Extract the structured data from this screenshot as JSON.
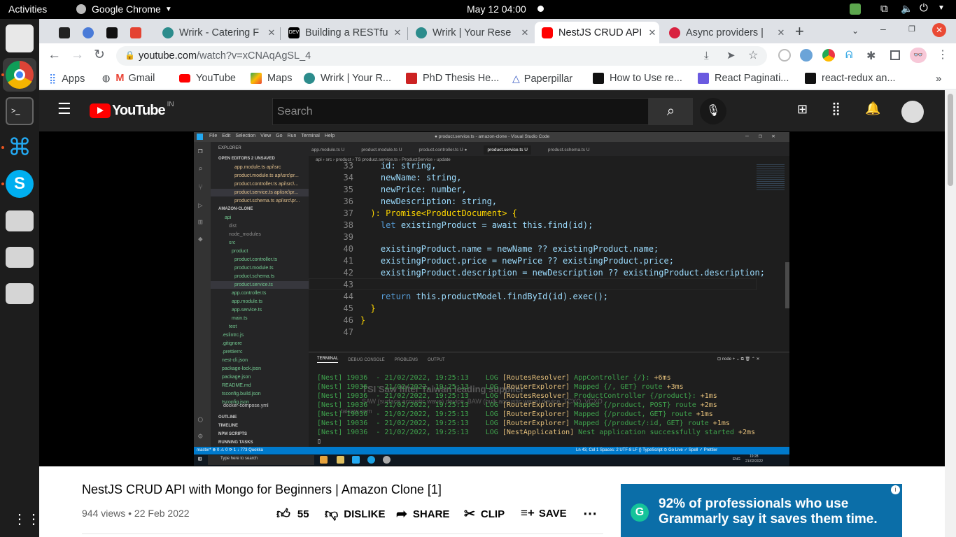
{
  "topbar": {
    "activities": "Activities",
    "app": "Google Chrome",
    "datetime": "May 12  04:00"
  },
  "tabs": [
    {
      "title": ""
    },
    {
      "title": ""
    },
    {
      "title": ""
    },
    {
      "title": ""
    },
    {
      "title": "Wrirk - Catering F"
    },
    {
      "title": "Building a RESTfu"
    },
    {
      "title": "Wrirk | Your Rese"
    },
    {
      "title": "NestJS CRUD API"
    },
    {
      "title": "Async providers |"
    }
  ],
  "omnibox": {
    "host": "youtube.com",
    "path": "/watch?v=xCNAqAgSL_4"
  },
  "bookmarks": [
    "Apps",
    "Gmail",
    "YouTube",
    "Maps",
    "Wrirk | Your R...",
    "PhD Thesis He...",
    "Paperpillar",
    "How to Use re...",
    "React Paginati...",
    "react-redux an..."
  ],
  "youtube": {
    "logo": "YouTube",
    "region": "IN",
    "search_placeholder": "Search",
    "video_title": "NestJS CRUD API with Mongo for Beginners | Amazon Clone [1]",
    "views_date": "944 views • 22 Feb 2022",
    "likes": "55",
    "dislike": "DISLIKE",
    "share": "SHARE",
    "clip": "CLIP",
    "save": "SAVE",
    "ad_text_1": "92% of professionals who use",
    "ad_text_2": "Grammarly say it saves them time."
  },
  "vscode": {
    "menu": [
      "File",
      "Edit",
      "Selection",
      "View",
      "Go",
      "Run",
      "Terminal",
      "Help"
    ],
    "window_title": "● product.service.ts - amazon-clone - Visual Studio Code",
    "editor_tabs": [
      "app.module.ts U",
      "product.module.ts U",
      "product.controller.ts U ●",
      "product.service.ts U",
      "product.schema.ts U"
    ],
    "breadcrumb": "api › src › product › TS product.service.ts › ProductService › update",
    "explorer_title": "EXPLORER",
    "open_editors": "OPEN EDITORS  2 UNSAVED",
    "open_files": [
      "app.module.ts api\\src",
      "product.module.ts api\\src\\pr...",
      "product.controller.ts api\\src\\...",
      "product.service.ts api\\src\\pr...",
      "product.schema.ts api\\src\\pr..."
    ],
    "project": "AMAZON-CLONE",
    "tree": [
      "api",
      "dist",
      "node_modules",
      "src",
      "product",
      "product.controller.ts",
      "product.module.ts",
      "product.schema.ts",
      "product.service.ts",
      "app.controller.ts",
      "app.module.ts",
      "app.service.ts",
      "main.ts",
      "test",
      ".eslintrc.js",
      ".gitignore",
      ".prettierrc",
      "nest-cli.json",
      "package-lock.json",
      "package.json",
      "README.md",
      "tsconfig.build.json",
      "tsconfig.json",
      "docker-compose.yml"
    ],
    "sections": [
      "OUTLINE",
      "TIMELINE",
      "NPM SCRIPTS",
      "RUNNING TASKS"
    ],
    "code_lines": [
      {
        "n": "33",
        "t": "    id: string,"
      },
      {
        "n": "34",
        "t": "    newName: string,"
      },
      {
        "n": "35",
        "t": "    newPrice: number,"
      },
      {
        "n": "36",
        "t": "    newDescription: string,"
      },
      {
        "n": "37",
        "t": "  ): Promise<ProductDocument> {"
      },
      {
        "n": "38",
        "t": "    let existingProduct = await this.find(id);"
      },
      {
        "n": "39",
        "t": ""
      },
      {
        "n": "40",
        "t": "    existingProduct.name = newName ?? existingProduct.name;"
      },
      {
        "n": "41",
        "t": "    existingProduct.price = newPrice ?? existingProduct.price;"
      },
      {
        "n": "42",
        "t": "    existingProduct.description = newDescription ?? existingProduct.description;"
      },
      {
        "n": "43",
        "t": ""
      },
      {
        "n": "44",
        "t": "    return this.productModel.findById(id).exec();"
      },
      {
        "n": "45",
        "t": "  }"
      },
      {
        "n": "46",
        "t": "}"
      },
      {
        "n": "47",
        "t": ""
      }
    ],
    "panel_tabs": [
      "TERMINAL",
      "DEBUG CONSOLE",
      "PROBLEMS",
      "OUTPUT"
    ],
    "terminal_shell": "node",
    "terminal_lines": [
      {
        "p": "[Nest] 19036  - 21/02/2022, 19:25:13",
        "l": "LOG",
        "c": "[RoutesResolver]",
        "m": "AppController {/}:",
        "t": "+6ms"
      },
      {
        "p": "[Nest] 19036  - 21/02/2022, 19:25:13",
        "l": "LOG",
        "c": "[RouterExplorer]",
        "m": "Mapped {/, GET} route",
        "t": "+3ms"
      },
      {
        "p": "[Nest] 19036  - 21/02/2022, 19:25:13",
        "l": "LOG",
        "c": "[RoutesResolver]",
        "m": "ProductController {/product}:",
        "t": "+1ms"
      },
      {
        "p": "[Nest] 19036  - 21/02/2022, 19:25:13",
        "l": "LOG",
        "c": "[RouterExplorer]",
        "m": "Mapped {/product, POST} route",
        "t": "+2ms"
      },
      {
        "p": "[Nest] 19036  - 21/02/2022, 19:25:13",
        "l": "LOG",
        "c": "[RouterExplorer]",
        "m": "Mapped {/product, GET} route",
        "t": "+1ms"
      },
      {
        "p": "[Nest] 19036  - 21/02/2022, 19:25:13",
        "l": "LOG",
        "c": "[RouterExplorer]",
        "m": "Mapped {/product/:id, GET} route",
        "t": "+1ms"
      },
      {
        "p": "[Nest] 19036  - 21/02/2022, 19:25:13",
        "l": "LOG",
        "c": "[NestApplication]",
        "m": "Nest application successfully started",
        "t": "+2ms"
      }
    ],
    "status_left": "master*   ⊗ 0 ⚠ 0   ⟳ 1 ↓ 773   Quokka",
    "status_right": "Ln 43, Col 1   Spaces: 2   UTF-8   LF   {} TypeScript   ⊙ Go Live   ✓ Spell   ✓ Prettier",
    "win_search": "Type here to search",
    "win_time": "19:28",
    "win_date": "21/02/2022",
    "win_lang": "ENG",
    "ad_overlay_1": "TSI Saw filter Taiwan leading supplier",
    "ad_overlay_2": "SAW (surface acoustic wave) device, BAW (bulk acoustic wave) device, TCXO, VCXO",
    "ad_overlay_3": "taisaw.com"
  },
  "colors": {
    "chrome_tab": "#dee1e6",
    "yt_dark": "#212121",
    "vsc_bg": "#1e1e1e",
    "vsc_status": "#007acc",
    "grammarly": "#0b6ea8"
  }
}
